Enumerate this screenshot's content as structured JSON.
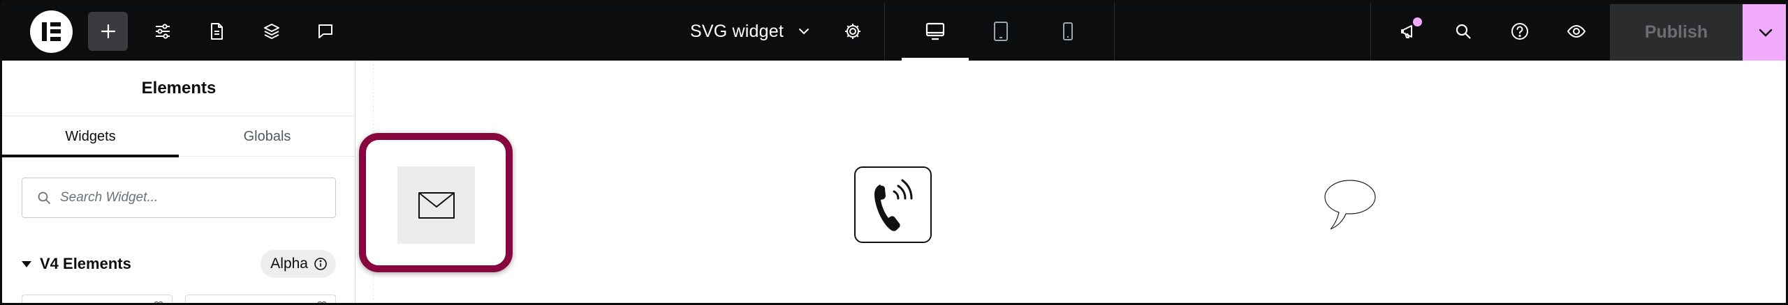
{
  "topbar": {
    "page_title": "SVG widget",
    "publish_label": "Publish",
    "accent_color": "#f0abfc",
    "icons": [
      "elementor-logo",
      "plus-icon",
      "sliders-icon",
      "page-icon",
      "layers-icon",
      "comment-icon",
      "chevron-down-icon",
      "gear-icon",
      "desktop-icon",
      "tablet-icon",
      "mobile-icon",
      "megaphone-icon",
      "search-icon",
      "help-icon",
      "eye-icon"
    ]
  },
  "panel": {
    "title": "Elements",
    "tabs": [
      {
        "label": "Widgets",
        "active": true
      },
      {
        "label": "Globals",
        "active": false
      }
    ],
    "search": {
      "placeholder": "Search Widget..."
    },
    "section": {
      "title": "V4 Elements",
      "badge": "Alpha"
    }
  },
  "canvas": {
    "widgets": [
      "envelope-svg",
      "telephone-svg",
      "speech-bubble-svg"
    ],
    "highlight_color": "#86063d"
  }
}
